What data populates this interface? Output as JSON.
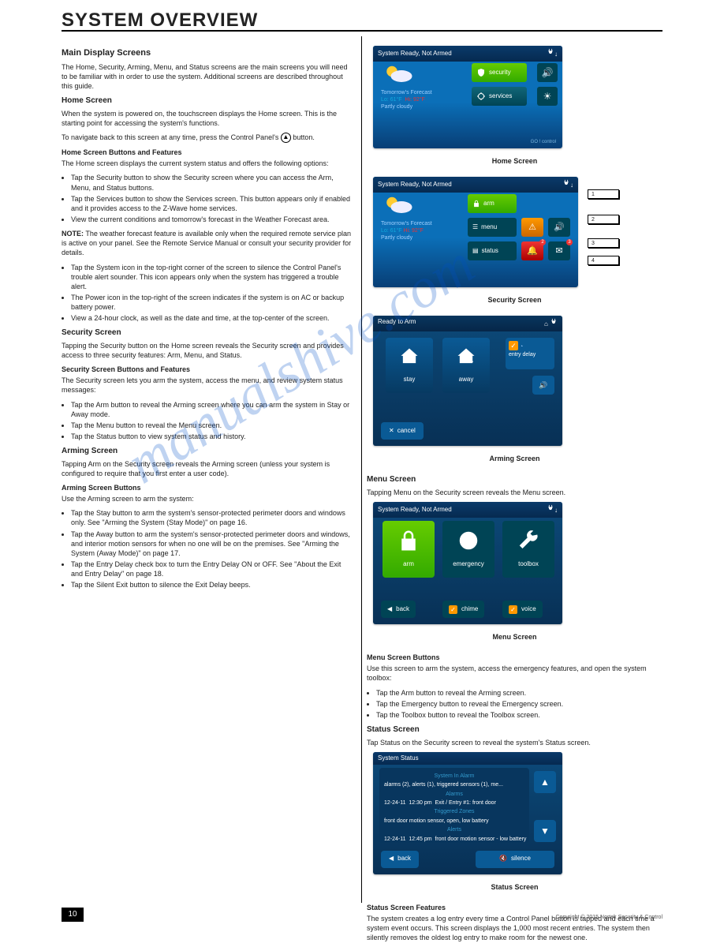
{
  "header": {
    "title": "SYSTEM OVERVIEW"
  },
  "watermark": "manualshive.com",
  "page_number": "10",
  "copyright": "Copyright © 2015 Nortek Security & Control",
  "left": {
    "h_display": "Main Display Screens",
    "p_display": "The Home, Security, Arming, Menu, and Status screens are the main screens you will need to be familiar with in order to use the system. Additional screens are described throughout this guide.",
    "h_home": "Home Screen",
    "p_home_1": "When the system is powered on, the touchscreen displays the Home screen. This is the starting point for accessing the system's functions.",
    "p_home_2": "To navigate back to this screen at any time, press the Control Panel's ",
    "p_home_3": " button.",
    "h_home_buttons": "Home Screen Buttons and Features",
    "p_home_buttons": "The Home screen displays the current system status and offers the following options:",
    "li_home": [
      "Tap the Security button to show the Security screen where you can access the Arm, Menu, and Status buttons.",
      "Tap the Services button to show the Services screen. This button appears only if enabled and it provides access to the Z-Wave home services.",
      "View the current conditions and tomorrow's forecast in the Weather Forecast area."
    ],
    "note_hd": "NOTE:",
    "note_txt": " The weather forecast feature is available only when the required remote service plan is active on your panel. See the Remote Service Manual or consult your security provider for details.",
    "li_home_more": [
      "Tap the System icon in the top-right corner of the screen to silence the Control Panel's trouble alert sounder. This icon appears only when the system has triggered a trouble alert.",
      "The Power icon in the top-right of the screen indicates if the system is on AC or backup battery power.",
      "View a 24-hour clock, as well as the date and time, at the top-center of the screen."
    ],
    "h_sec": "Security Screen",
    "p_sec_1": "Tapping the Security button on the Home screen reveals the Security screen and provides access to three security features: Arm, Menu, and Status.",
    "h_sec_buttons": "Security Screen Buttons and Features",
    "p_sec_buttons": "The Security screen lets you arm the system, access the menu, and review system status messages:",
    "li_sec": [
      "Tap the Arm button to reveal the Arming screen where you can arm the system in Stay or Away mode.",
      "Tap the Menu button to reveal the Menu screen.",
      "Tap the Status button to view system status and history."
    ],
    "h_arming": "Arming Screen",
    "p_arming": "Tapping Arm on the Security screen reveals the Arming screen (unless your system is configured to require that you first enter a user code).",
    "h_arming_buttons": "Arming Screen Buttons",
    "p_arming_buttons": "Use the Arming screen to arm the system:",
    "li_arm": [
      "Tap the Stay button to arm the system's sensor-protected perimeter doors and windows only. See \"Arming the System (Stay Mode)\" on page 16.",
      "Tap the Away button to arm the system's sensor-protected perimeter doors and windows, and interior motion sensors for when no one will be on the premises. See \"Arming the System (Away Mode)\" on page 17.",
      "Tap the Entry Delay check box to turn the Entry Delay ON or OFF. See \"About the Exit and Entry Delay\" on page 18.",
      "Tap the Silent Exit button to silence the Exit Delay beeps."
    ]
  },
  "right": {
    "cap_home": "Home Screen",
    "cap_sec": "Security Screen",
    "cap_arm": "Arming Screen",
    "cap_menu": "Menu Screen",
    "cap_status": "Status Screen",
    "home_scr": {
      "status": "System Ready, Not Armed",
      "btn_security": "security",
      "btn_services": "services",
      "forecast_label": "Tomorrow's Forecast",
      "lo_label": "Lo:",
      "lo": "61°F",
      "hi_label": "Hi:",
      "hi": "92°F",
      "cond": "Partly cloudy",
      "logo": "GO ! control"
    },
    "sec_scr": {
      "status": "System Ready, Not Armed",
      "arm": "arm",
      "menu": "menu",
      "status_btn": "status",
      "badge_c": "2",
      "badge_d": "3",
      "callouts": [
        "1",
        "2",
        "3",
        "4"
      ]
    },
    "arm_scr": {
      "title": "Ready to Arm",
      "stay": "stay",
      "away": "away",
      "entry": "entry delay",
      "cancel": "cancel"
    },
    "menu_scr": {
      "status": "System Ready, Not Armed",
      "arm": "arm",
      "em": "emergency",
      "tb": "toolbox",
      "back": "back",
      "chime": "chime",
      "voice": "voice"
    },
    "status_scr": {
      "title": "System Status",
      "hd_sys": "System In Alarm",
      "line1": "alarms (2), alerts (1), triggered sensors (1), me...",
      "hd_al": "Alarms",
      "line2_date": "12-24-11",
      "line2_time": "12:30 pm",
      "line2_txt": "Exit / Entry #1: front door",
      "hd_tz": "Triggered Zones",
      "line3": "front door motion sensor, open, low battery",
      "hd_alerts": "Alerts",
      "line4_date": "12-24-11",
      "line4_time": "12:45 pm",
      "line4_txt": "front door motion sensor - low battery",
      "back": "back",
      "silence": "silence"
    },
    "h_menu": "Menu Screen",
    "p_menu": "Tapping Menu on the Security screen reveals the Menu screen.",
    "h_menu_buttons": "Menu Screen Buttons",
    "p_menu_buttons": "Use this screen to arm the system, access the emergency features, and open the system toolbox:",
    "li_menu": [
      "Tap the Arm button to reveal the Arming screen.",
      "Tap the Emergency button to reveal the Emergency screen.",
      "Tap the Toolbox button to reveal the Toolbox screen."
    ],
    "h_status": "Status Screen",
    "p_status_1": "Tap Status on the Security screen to reveal the system's Status screen.",
    "h_status_features": "Status Screen Features",
    "p_status_features": "The system creates a log entry every time a Control Panel button is tapped and each time a system event occurs. This screen displays the 1,000 most recent entries. The system then silently removes the oldest log entry to make room for the newest one."
  }
}
